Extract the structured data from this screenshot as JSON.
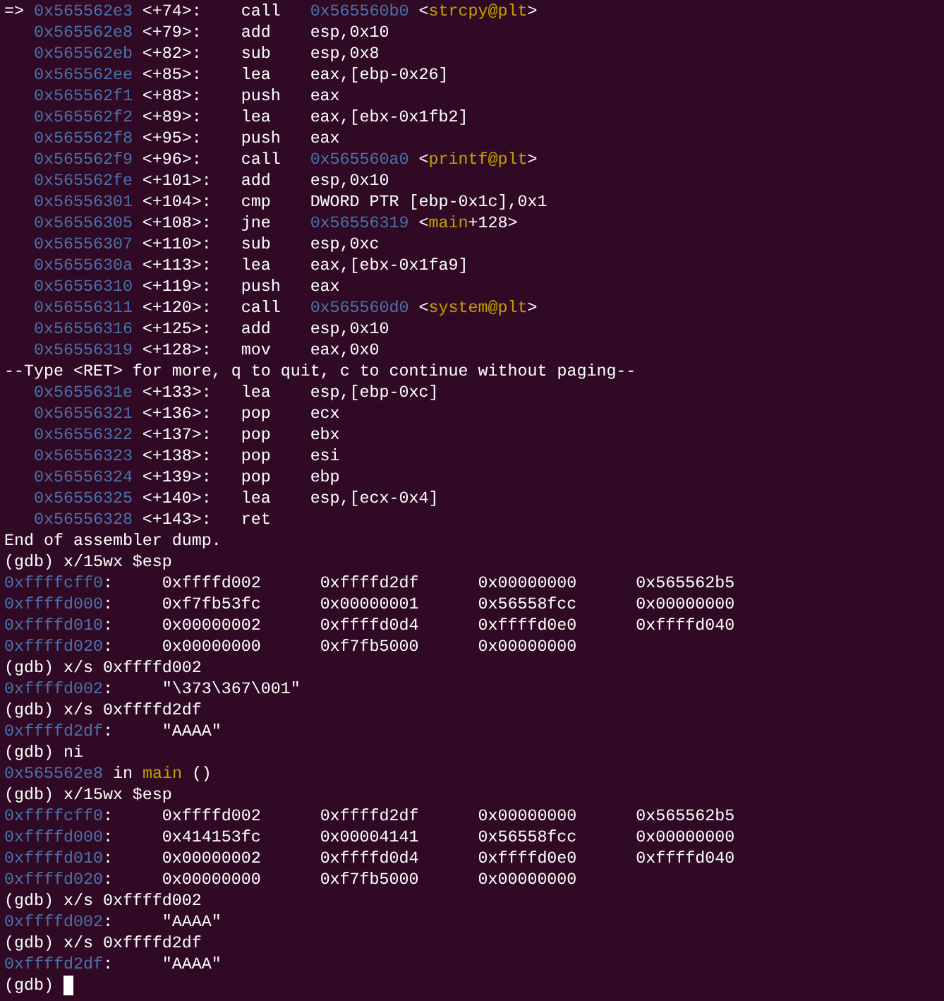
{
  "lines": [
    {
      "kind": "asm",
      "marker": "=>",
      "address": "0x565562e3",
      "offset": "<+74>:",
      "mnemonic": "call",
      "target": "0x565560b0",
      "symbol": {
        "open": "<",
        "name": "strcpy@plt",
        "close": ">"
      }
    },
    {
      "kind": "asm",
      "address": "0x565562e8",
      "offset": "<+79>:",
      "mnemonic": "add",
      "operand": "esp,0x10"
    },
    {
      "kind": "asm",
      "address": "0x565562eb",
      "offset": "<+82>:",
      "mnemonic": "sub",
      "operand": "esp,0x8"
    },
    {
      "kind": "asm",
      "address": "0x565562ee",
      "offset": "<+85>:",
      "mnemonic": "lea",
      "operand": "eax,[ebp-0x26]"
    },
    {
      "kind": "asm",
      "address": "0x565562f1",
      "offset": "<+88>:",
      "mnemonic": "push",
      "operand": "eax"
    },
    {
      "kind": "asm",
      "address": "0x565562f2",
      "offset": "<+89>:",
      "mnemonic": "lea",
      "operand": "eax,[ebx-0x1fb2]"
    },
    {
      "kind": "asm",
      "address": "0x565562f8",
      "offset": "<+95>:",
      "mnemonic": "push",
      "operand": "eax"
    },
    {
      "kind": "asm",
      "address": "0x565562f9",
      "offset": "<+96>:",
      "mnemonic": "call",
      "target": "0x565560a0",
      "symbol": {
        "open": "<",
        "name": "printf@plt",
        "close": ">"
      }
    },
    {
      "kind": "asm",
      "address": "0x565562fe",
      "offset": "<+101>:",
      "mnemonic": "add",
      "operand": "esp,0x10"
    },
    {
      "kind": "asm",
      "address": "0x56556301",
      "offset": "<+104>:",
      "mnemonic": "cmp",
      "operand": "DWORD PTR [ebp-0x1c],0x1"
    },
    {
      "kind": "asm",
      "address": "0x56556305",
      "offset": "<+108>:",
      "mnemonic": "jne",
      "target": "0x56556319",
      "symbol": {
        "open": "<",
        "name": "main",
        "close": "+128>"
      }
    },
    {
      "kind": "asm",
      "address": "0x56556307",
      "offset": "<+110>:",
      "mnemonic": "sub",
      "operand": "esp,0xc"
    },
    {
      "kind": "asm",
      "address": "0x5655630a",
      "offset": "<+113>:",
      "mnemonic": "lea",
      "operand": "eax,[ebx-0x1fa9]"
    },
    {
      "kind": "asm",
      "address": "0x56556310",
      "offset": "<+119>:",
      "mnemonic": "push",
      "operand": "eax"
    },
    {
      "kind": "asm",
      "address": "0x56556311",
      "offset": "<+120>:",
      "mnemonic": "call",
      "target": "0x565560d0",
      "symbol": {
        "open": "<",
        "name": "system@plt",
        "close": ">"
      }
    },
    {
      "kind": "asm",
      "address": "0x56556316",
      "offset": "<+125>:",
      "mnemonic": "add",
      "operand": "esp,0x10"
    },
    {
      "kind": "asm",
      "address": "0x56556319",
      "offset": "<+128>:",
      "mnemonic": "mov",
      "operand": "eax,0x0"
    },
    {
      "kind": "text",
      "text": "--Type <RET> for more, q to quit, c to continue without paging--"
    },
    {
      "kind": "asm",
      "address": "0x5655631e",
      "offset": "<+133>:",
      "mnemonic": "lea",
      "operand": "esp,[ebp-0xc]"
    },
    {
      "kind": "asm",
      "address": "0x56556321",
      "offset": "<+136>:",
      "mnemonic": "pop",
      "operand": "ecx"
    },
    {
      "kind": "asm",
      "address": "0x56556322",
      "offset": "<+137>:",
      "mnemonic": "pop",
      "operand": "ebx"
    },
    {
      "kind": "asm",
      "address": "0x56556323",
      "offset": "<+138>:",
      "mnemonic": "pop",
      "operand": "esi"
    },
    {
      "kind": "asm",
      "address": "0x56556324",
      "offset": "<+139>:",
      "mnemonic": "pop",
      "operand": "ebp"
    },
    {
      "kind": "asm",
      "address": "0x56556325",
      "offset": "<+140>:",
      "mnemonic": "lea",
      "operand": "esp,[ecx-0x4]"
    },
    {
      "kind": "asm",
      "address": "0x56556328",
      "offset": "<+143>:",
      "mnemonic": "ret"
    },
    {
      "kind": "text",
      "text": "End of assembler dump."
    },
    {
      "kind": "command",
      "text": "(gdb) x/15wx $esp"
    },
    {
      "kind": "mem",
      "address": "0xffffcff0",
      "sep": ":",
      "values": [
        "0xffffd002",
        "0xffffd2df",
        "0x00000000",
        "0x565562b5"
      ]
    },
    {
      "kind": "mem",
      "address": "0xffffd000",
      "sep": ":",
      "values": [
        "0xf7fb53fc",
        "0x00000001",
        "0x56558fcc",
        "0x00000000"
      ]
    },
    {
      "kind": "mem",
      "address": "0xffffd010",
      "sep": ":",
      "values": [
        "0x00000002",
        "0xffffd0d4",
        "0xffffd0e0",
        "0xffffd040"
      ]
    },
    {
      "kind": "mem",
      "address": "0xffffd020",
      "sep": ":",
      "values": [
        "0x00000000",
        "0xf7fb5000",
        "0x00000000"
      ]
    },
    {
      "kind": "command",
      "text": "(gdb) x/s 0xffffd002"
    },
    {
      "kind": "mem",
      "address": "0xffffd002",
      "sep": ":",
      "values": [
        "\"\\373\\367\\001\""
      ]
    },
    {
      "kind": "command",
      "text": "(gdb) x/s 0xffffd2df"
    },
    {
      "kind": "mem",
      "address": "0xffffd2df",
      "sep": ":",
      "values": [
        "\"AAAA\""
      ]
    },
    {
      "kind": "command",
      "text": "(gdb) ni"
    },
    {
      "kind": "frame",
      "address": "0x565562e8",
      "in": "in",
      "function": "main",
      "args": "()"
    },
    {
      "kind": "command",
      "text": "(gdb) x/15wx $esp"
    },
    {
      "kind": "mem",
      "address": "0xffffcff0",
      "sep": ":",
      "values": [
        "0xffffd002",
        "0xffffd2df",
        "0x00000000",
        "0x565562b5"
      ]
    },
    {
      "kind": "mem",
      "address": "0xffffd000",
      "sep": ":",
      "values": [
        "0x414153fc",
        "0x00004141",
        "0x56558fcc",
        "0x00000000"
      ]
    },
    {
      "kind": "mem",
      "address": "0xffffd010",
      "sep": ":",
      "values": [
        "0x00000002",
        "0xffffd0d4",
        "0xffffd0e0",
        "0xffffd040"
      ]
    },
    {
      "kind": "mem",
      "address": "0xffffd020",
      "sep": ":",
      "values": [
        "0x00000000",
        "0xf7fb5000",
        "0x00000000"
      ]
    },
    {
      "kind": "command",
      "text": "(gdb) x/s 0xffffd002"
    },
    {
      "kind": "mem",
      "address": "0xffffd002",
      "sep": ":",
      "values": [
        "\"AAAA\""
      ]
    },
    {
      "kind": "command",
      "text": "(gdb) x/s 0xffffd2df"
    },
    {
      "kind": "mem",
      "address": "0xffffd2df",
      "sep": ":",
      "values": [
        "\"AAAA\""
      ]
    },
    {
      "kind": "command",
      "text": "(gdb)",
      "cursor": true
    }
  ]
}
